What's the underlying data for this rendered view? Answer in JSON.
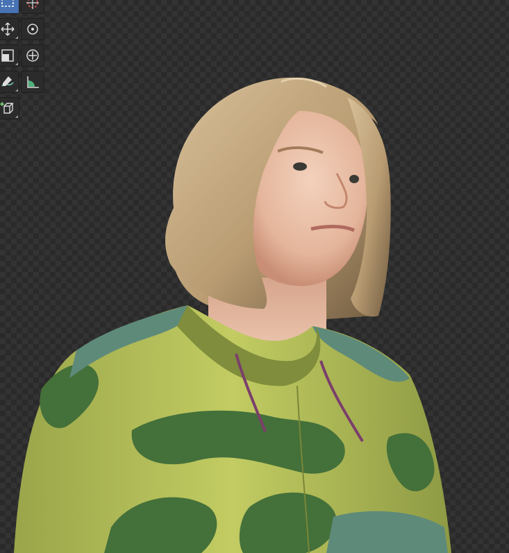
{
  "viewport": {
    "background": "checkerboard-transparent",
    "subject": "character-bust-render",
    "colors": {
      "hoodie_light": "#b9c35a",
      "hoodie_dark": "#3f6a34",
      "hoodie_teal": "#5e8a7a",
      "hair": "#c7ab82",
      "skin": "#eac4ab",
      "drawstring": "#7b3f6a"
    }
  },
  "toolbar": {
    "tools": [
      {
        "name": "select-box-icon",
        "active": true
      },
      {
        "name": "cursor-icon",
        "active": false
      },
      {
        "name": "move-icon",
        "active": false
      },
      {
        "name": "rotate-icon",
        "active": false
      },
      {
        "name": "scale-icon",
        "active": false
      },
      {
        "name": "transform-icon",
        "active": false
      },
      {
        "name": "annotate-icon",
        "active": false
      },
      {
        "name": "measure-icon",
        "active": false
      },
      {
        "name": "add-cube-icon",
        "active": false
      }
    ]
  }
}
